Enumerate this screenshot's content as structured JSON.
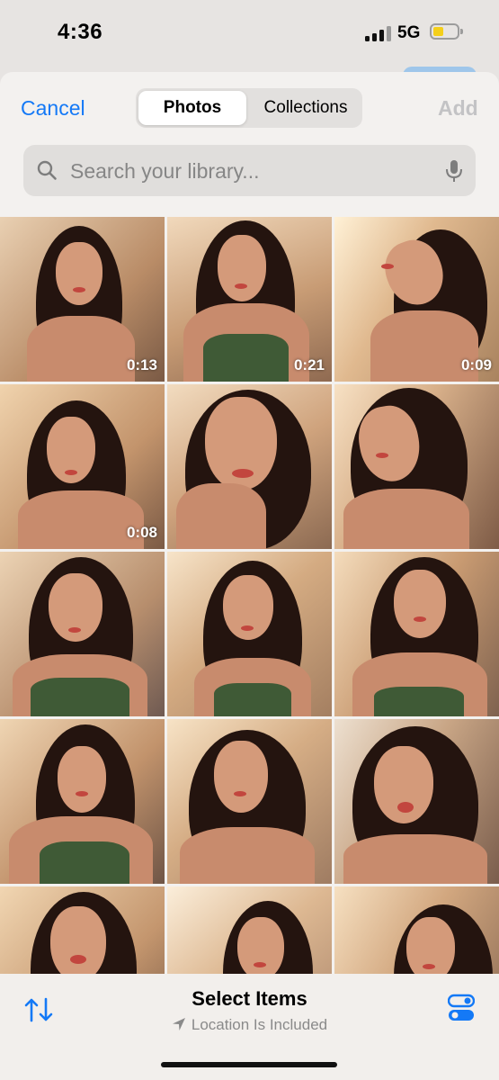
{
  "status_bar": {
    "time": "4:36",
    "network": "5G",
    "battery_color": "#f4cf1a"
  },
  "header": {
    "cancel_label": "Cancel",
    "tabs": [
      {
        "label": "Photos",
        "selected": true
      },
      {
        "label": "Collections",
        "selected": false
      }
    ],
    "add_label": "Add"
  },
  "search": {
    "placeholder": "Search your library...",
    "icon": "search-icon",
    "mic_icon": "microphone-icon"
  },
  "grid": {
    "photos": [
      {
        "duration": "0:13"
      },
      {
        "duration": "0:21"
      },
      {
        "duration": "0:09"
      },
      {
        "duration": "0:08"
      },
      {
        "duration": ""
      },
      {
        "duration": ""
      },
      {
        "duration": ""
      },
      {
        "duration": ""
      },
      {
        "duration": ""
      },
      {
        "duration": ""
      },
      {
        "duration": ""
      },
      {
        "duration": ""
      },
      {
        "duration": ""
      },
      {
        "duration": ""
      },
      {
        "duration": ""
      }
    ]
  },
  "toolbar": {
    "title": "Select Items",
    "subtitle": "Location Is Included",
    "sort_icon": "sort-arrows-icon",
    "options_icon": "toggle-options-icon",
    "accent": "#1479f6"
  }
}
